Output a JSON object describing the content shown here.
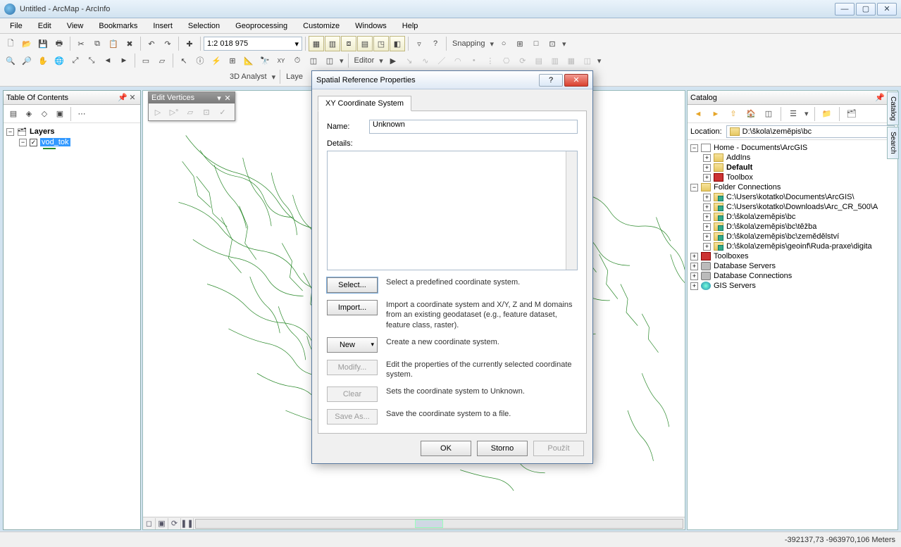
{
  "window": {
    "title": "Untitled - ArcMap - ArcInfo"
  },
  "menu": [
    "File",
    "Edit",
    "View",
    "Bookmarks",
    "Insert",
    "Selection",
    "Geoprocessing",
    "Customize",
    "Windows",
    "Help"
  ],
  "toolbar": {
    "scale": "1:2 018 975",
    "editor_label": "Editor",
    "snapping_label": "Snapping",
    "analyst_label": "3D Analyst",
    "layer_label": "Laye"
  },
  "toc": {
    "title": "Table Of Contents",
    "root": "Layers",
    "layer": "vod_tok"
  },
  "edit_vertices": {
    "title": "Edit Vertices"
  },
  "catalog": {
    "title": "Catalog",
    "location_label": "Location:",
    "location_value": "D:\\škola\\zeměpis\\bc",
    "tree": {
      "home": "Home - Documents\\ArcGIS",
      "home_children": [
        "AddIns",
        "Default",
        "Toolbox"
      ],
      "folder_conn": "Folder Connections",
      "folders": [
        "C:\\Users\\kotatko\\Documents\\ArcGIS\\",
        "C:\\Users\\kotatko\\Downloads\\Arc_CR_500\\A",
        "D:\\škola\\zeměpis\\bc",
        "D:\\škola\\zeměpis\\bc\\těžba",
        "D:\\škola\\zeměpis\\bc\\zemědělství",
        "D:\\škola\\zeměpis\\geoinf\\Ruda-praxe\\digita"
      ],
      "toolboxes": "Toolboxes",
      "db_servers": "Database Servers",
      "db_conn": "Database Connections",
      "gis_servers": "GIS Servers"
    }
  },
  "side_tabs": [
    "Catalog",
    "Search"
  ],
  "dialog": {
    "title": "Spatial Reference Properties",
    "tab": "XY Coordinate System",
    "name_label": "Name:",
    "name_value": "Unknown",
    "details_label": "Details:",
    "buttons": {
      "select": "Select...",
      "select_desc": "Select a predefined coordinate system.",
      "import": "Import...",
      "import_desc": "Import a coordinate system and X/Y, Z and M domains from an existing geodataset (e.g., feature dataset, feature class, raster).",
      "new": "New",
      "new_desc": "Create a new coordinate system.",
      "modify": "Modify...",
      "modify_desc": "Edit the properties of the currently selected coordinate system.",
      "clear": "Clear",
      "clear_desc": "Sets the coordinate system to Unknown.",
      "saveas": "Save As...",
      "saveas_desc": "Save the coordinate system to a file."
    },
    "footer": {
      "ok": "OK",
      "cancel": "Storno",
      "apply": "Použít"
    }
  },
  "status": {
    "coords": "-392137,73 -963970,106 Meters"
  }
}
